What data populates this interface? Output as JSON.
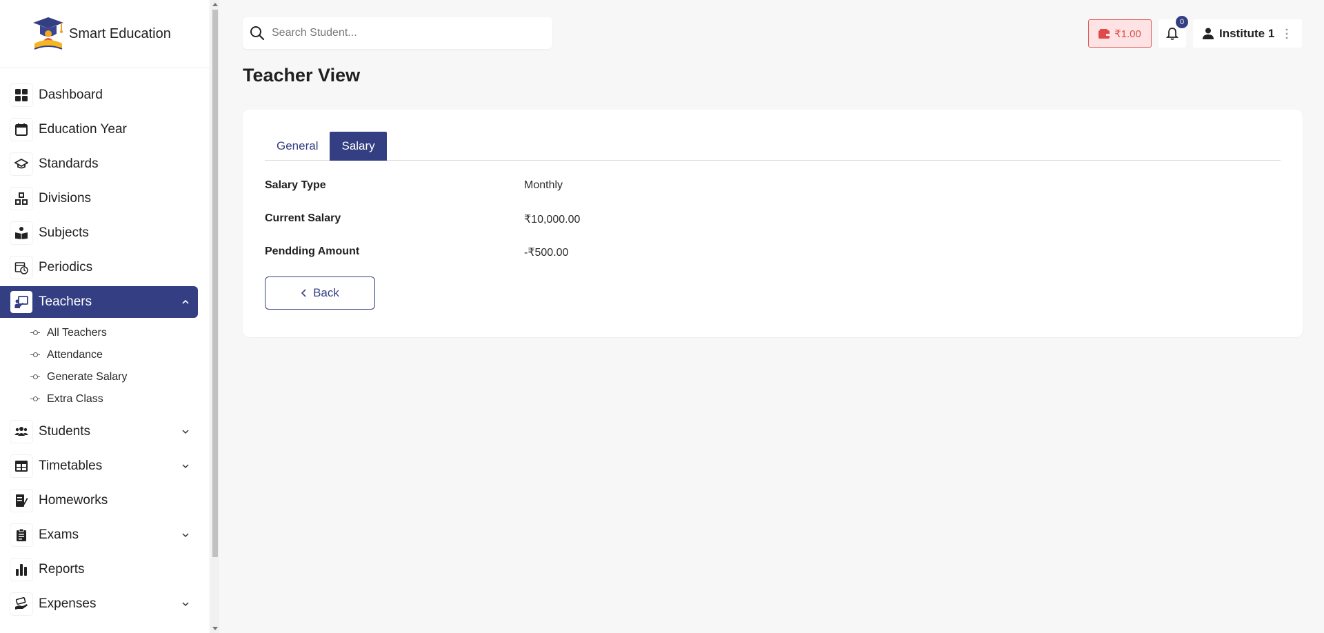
{
  "brand": {
    "name": "Smart Education"
  },
  "sidebar": {
    "items": [
      {
        "label": "Dashboard",
        "icon": "grid-icon"
      },
      {
        "label": "Education Year",
        "icon": "calendar-icon"
      },
      {
        "label": "Standards",
        "icon": "graduation-cap-icon"
      },
      {
        "label": "Divisions",
        "icon": "abc-blocks-icon"
      },
      {
        "label": "Subjects",
        "icon": "book-reader-icon"
      },
      {
        "label": "Periodics",
        "icon": "calendar-clock-icon"
      },
      {
        "label": "Teachers",
        "icon": "chalkboard-teacher-icon",
        "active": true
      },
      {
        "label": "Students",
        "icon": "users-icon"
      },
      {
        "label": "Timetables",
        "icon": "table-icon"
      },
      {
        "label": "Homeworks",
        "icon": "notebook-pen-icon"
      },
      {
        "label": "Exams",
        "icon": "clipboard-list-icon"
      },
      {
        "label": "Reports",
        "icon": "bar-chart-icon"
      },
      {
        "label": "Expenses",
        "icon": "hand-money-icon"
      }
    ],
    "teachers_sub": [
      "All Teachers",
      "Attendance",
      "Generate Salary",
      "Extra Class"
    ]
  },
  "topbar": {
    "search_placeholder": "Search Student...",
    "wallet_amount": "₹1.00",
    "notifications_count": "0",
    "user_name": "Institute 1"
  },
  "page": {
    "title": "Teacher View",
    "tabs": [
      {
        "label": "General",
        "active": false
      },
      {
        "label": "Salary",
        "active": true
      }
    ],
    "fields": [
      {
        "key": "Salary Type",
        "value": "Monthly"
      },
      {
        "key": "Current Salary",
        "value": "₹10,000.00"
      },
      {
        "key": "Pendding Amount",
        "value": "-₹500.00"
      }
    ],
    "back_label": "Back"
  },
  "colors": {
    "primary": "#343e82",
    "wallet_bg": "#fde3e3",
    "wallet_text": "#e04a4a",
    "page_bg": "#f7f7f7"
  }
}
